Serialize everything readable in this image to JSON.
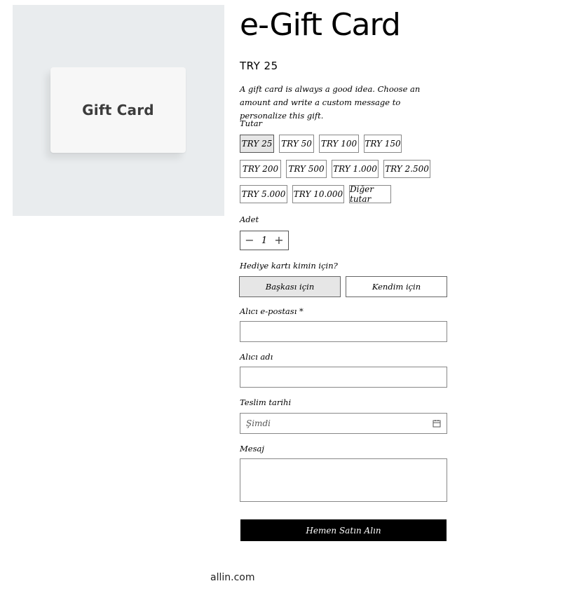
{
  "product": {
    "card_text": "Gift Card",
    "title": "e-Gift Card",
    "price": "TRY 25",
    "description": "A gift card is always a good idea. Choose an amount and write a custom message to personalize this gift."
  },
  "amount": {
    "label": "Tutar",
    "options": [
      "TRY 25",
      "TRY 50",
      "TRY 100",
      "TRY 150",
      "TRY 200",
      "TRY 500",
      "TRY 1.000",
      "TRY 2.500",
      "TRY 5.000",
      "TRY 10.000",
      "Diğer tutar"
    ],
    "selected": "TRY 25"
  },
  "quantity": {
    "label": "Adet",
    "value": "1",
    "minus": "−",
    "plus": "+"
  },
  "recipient_type": {
    "label": "Hediye kartı kimin için?",
    "options": [
      "Başkası için",
      "Kendim için"
    ],
    "selected": "Başkası için"
  },
  "form": {
    "email_label": "Alıcı e-postası *",
    "email_value": "",
    "name_label": "Alıcı adı",
    "name_value": "",
    "date_label": "Teslim tarihi",
    "date_value": "Şimdi",
    "message_label": "Mesaj",
    "message_value": ""
  },
  "buy_button": "Hemen Satın Alın",
  "footer": "allin.com"
}
